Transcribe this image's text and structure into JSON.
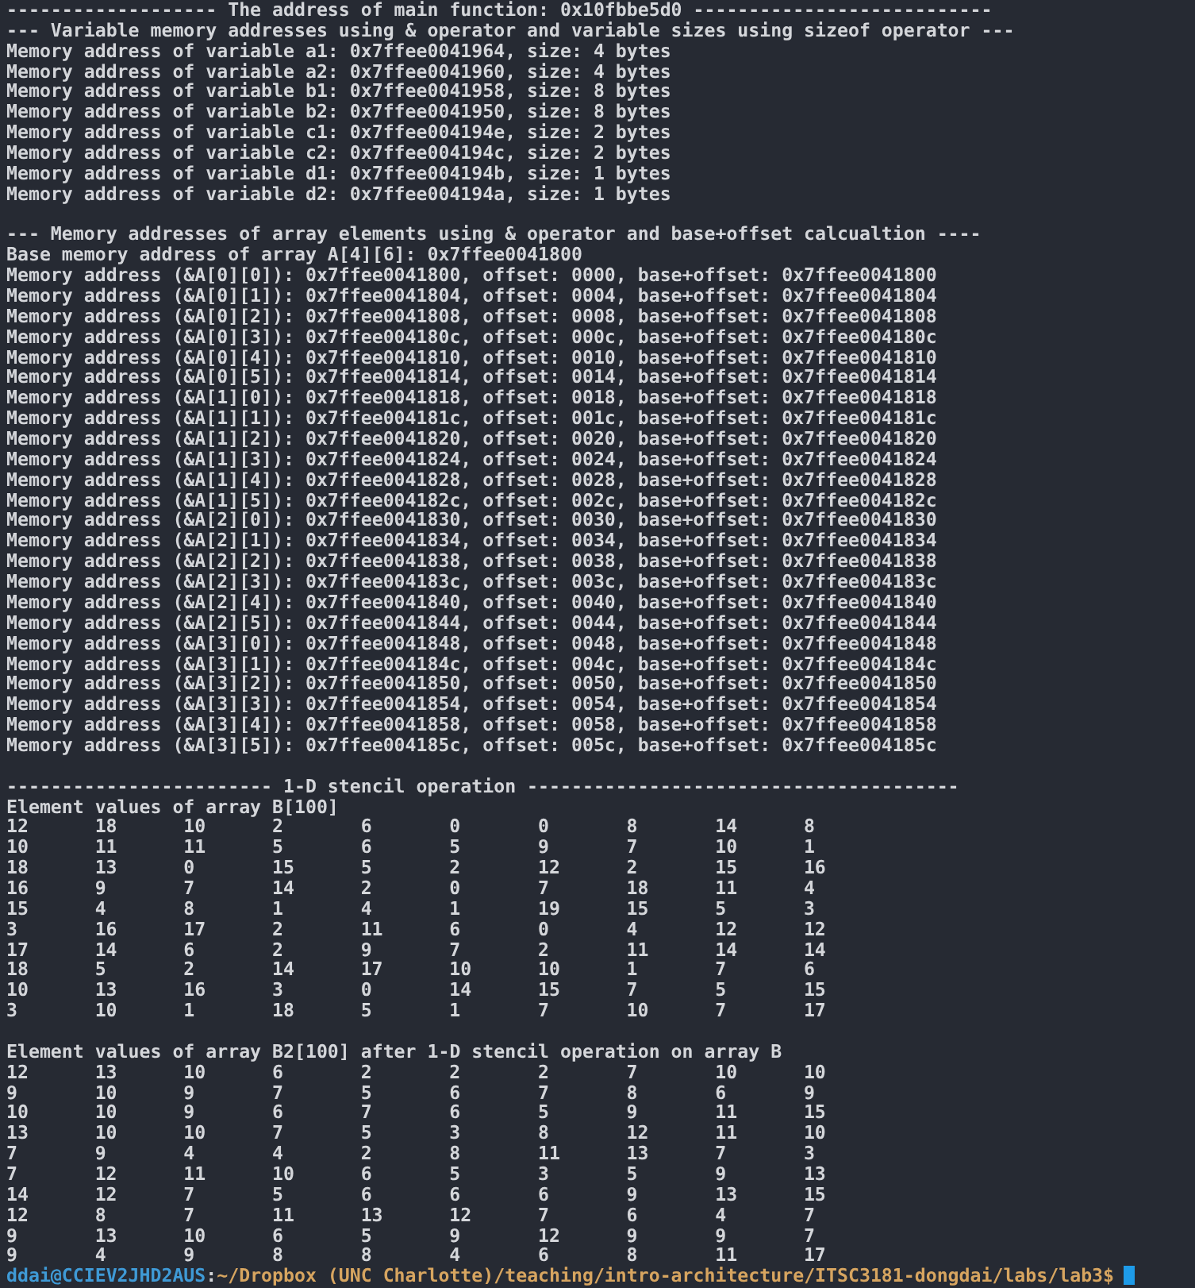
{
  "terminal": {
    "lines": [
      {
        "kind": "text",
        "text": "------------------- The address of main function: 0x10fbbe5d0 ---------------------------"
      },
      {
        "kind": "text",
        "text": "--- Variable memory addresses using & operator and variable sizes using sizeof operator ---"
      },
      {
        "kind": "text",
        "text": "Memory address of variable a1: 0x7ffee0041964, size: 4 bytes"
      },
      {
        "kind": "text",
        "text": "Memory address of variable a2: 0x7ffee0041960, size: 4 bytes"
      },
      {
        "kind": "text",
        "text": "Memory address of variable b1: 0x7ffee0041958, size: 8 bytes"
      },
      {
        "kind": "text",
        "text": "Memory address of variable b2: 0x7ffee0041950, size: 8 bytes"
      },
      {
        "kind": "text",
        "text": "Memory address of variable c1: 0x7ffee004194e, size: 2 bytes"
      },
      {
        "kind": "text",
        "text": "Memory address of variable c2: 0x7ffee004194c, size: 2 bytes"
      },
      {
        "kind": "text",
        "text": "Memory address of variable d1: 0x7ffee004194b, size: 1 bytes"
      },
      {
        "kind": "text",
        "text": "Memory address of variable d2: 0x7ffee004194a, size: 1 bytes"
      },
      {
        "kind": "blank"
      },
      {
        "kind": "text",
        "text": "--- Memory addresses of array elements using & operator and base+offset calcualtion ----"
      },
      {
        "kind": "text",
        "text": "Base memory address of array A[4][6]: 0x7ffee0041800"
      },
      {
        "kind": "text",
        "text": "Memory address (&A[0][0]): 0x7ffee0041800, offset: 0000, base+offset: 0x7ffee0041800"
      },
      {
        "kind": "text",
        "text": "Memory address (&A[0][1]): 0x7ffee0041804, offset: 0004, base+offset: 0x7ffee0041804"
      },
      {
        "kind": "text",
        "text": "Memory address (&A[0][2]): 0x7ffee0041808, offset: 0008, base+offset: 0x7ffee0041808"
      },
      {
        "kind": "text",
        "text": "Memory address (&A[0][3]): 0x7ffee004180c, offset: 000c, base+offset: 0x7ffee004180c"
      },
      {
        "kind": "text",
        "text": "Memory address (&A[0][4]): 0x7ffee0041810, offset: 0010, base+offset: 0x7ffee0041810"
      },
      {
        "kind": "text",
        "text": "Memory address (&A[0][5]): 0x7ffee0041814, offset: 0014, base+offset: 0x7ffee0041814"
      },
      {
        "kind": "text",
        "text": "Memory address (&A[1][0]): 0x7ffee0041818, offset: 0018, base+offset: 0x7ffee0041818"
      },
      {
        "kind": "text",
        "text": "Memory address (&A[1][1]): 0x7ffee004181c, offset: 001c, base+offset: 0x7ffee004181c"
      },
      {
        "kind": "text",
        "text": "Memory address (&A[1][2]): 0x7ffee0041820, offset: 0020, base+offset: 0x7ffee0041820"
      },
      {
        "kind": "text",
        "text": "Memory address (&A[1][3]): 0x7ffee0041824, offset: 0024, base+offset: 0x7ffee0041824"
      },
      {
        "kind": "text",
        "text": "Memory address (&A[1][4]): 0x7ffee0041828, offset: 0028, base+offset: 0x7ffee0041828"
      },
      {
        "kind": "text",
        "text": "Memory address (&A[1][5]): 0x7ffee004182c, offset: 002c, base+offset: 0x7ffee004182c"
      },
      {
        "kind": "text",
        "text": "Memory address (&A[2][0]): 0x7ffee0041830, offset: 0030, base+offset: 0x7ffee0041830"
      },
      {
        "kind": "text",
        "text": "Memory address (&A[2][1]): 0x7ffee0041834, offset: 0034, base+offset: 0x7ffee0041834"
      },
      {
        "kind": "text",
        "text": "Memory address (&A[2][2]): 0x7ffee0041838, offset: 0038, base+offset: 0x7ffee0041838"
      },
      {
        "kind": "text",
        "text": "Memory address (&A[2][3]): 0x7ffee004183c, offset: 003c, base+offset: 0x7ffee004183c"
      },
      {
        "kind": "text",
        "text": "Memory address (&A[2][4]): 0x7ffee0041840, offset: 0040, base+offset: 0x7ffee0041840"
      },
      {
        "kind": "text",
        "text": "Memory address (&A[2][5]): 0x7ffee0041844, offset: 0044, base+offset: 0x7ffee0041844"
      },
      {
        "kind": "text",
        "text": "Memory address (&A[3][0]): 0x7ffee0041848, offset: 0048, base+offset: 0x7ffee0041848"
      },
      {
        "kind": "text",
        "text": "Memory address (&A[3][1]): 0x7ffee004184c, offset: 004c, base+offset: 0x7ffee004184c"
      },
      {
        "kind": "text",
        "text": "Memory address (&A[3][2]): 0x7ffee0041850, offset: 0050, base+offset: 0x7ffee0041850"
      },
      {
        "kind": "text",
        "text": "Memory address (&A[3][3]): 0x7ffee0041854, offset: 0054, base+offset: 0x7ffee0041854"
      },
      {
        "kind": "text",
        "text": "Memory address (&A[3][4]): 0x7ffee0041858, offset: 0058, base+offset: 0x7ffee0041858"
      },
      {
        "kind": "text",
        "text": "Memory address (&A[3][5]): 0x7ffee004185c, offset: 005c, base+offset: 0x7ffee004185c"
      },
      {
        "kind": "blank"
      },
      {
        "kind": "text",
        "text": "------------------------ 1-D stencil operation ---------------------------------------"
      },
      {
        "kind": "text",
        "text": "Element values of array B[100]"
      },
      {
        "kind": "values",
        "values": [
          "12",
          "18",
          "10",
          "2",
          "6",
          "0",
          "0",
          "8",
          "14",
          "8"
        ]
      },
      {
        "kind": "values",
        "values": [
          "10",
          "11",
          "11",
          "5",
          "6",
          "5",
          "9",
          "7",
          "10",
          "1"
        ]
      },
      {
        "kind": "values",
        "values": [
          "18",
          "13",
          "0",
          "15",
          "5",
          "2",
          "12",
          "2",
          "15",
          "16"
        ]
      },
      {
        "kind": "values",
        "values": [
          "16",
          "9",
          "7",
          "14",
          "2",
          "0",
          "7",
          "18",
          "11",
          "4"
        ]
      },
      {
        "kind": "values",
        "values": [
          "15",
          "4",
          "8",
          "1",
          "4",
          "1",
          "19",
          "15",
          "5",
          "3"
        ]
      },
      {
        "kind": "values",
        "values": [
          "3",
          "16",
          "17",
          "2",
          "11",
          "6",
          "0",
          "4",
          "12",
          "12"
        ]
      },
      {
        "kind": "values",
        "values": [
          "17",
          "14",
          "6",
          "2",
          "9",
          "7",
          "2",
          "11",
          "14",
          "14"
        ]
      },
      {
        "kind": "values",
        "values": [
          "18",
          "5",
          "2",
          "14",
          "17",
          "10",
          "10",
          "1",
          "7",
          "6"
        ]
      },
      {
        "kind": "values",
        "values": [
          "10",
          "13",
          "16",
          "3",
          "0",
          "14",
          "15",
          "7",
          "5",
          "15"
        ]
      },
      {
        "kind": "values",
        "values": [
          "3",
          "10",
          "1",
          "18",
          "5",
          "1",
          "7",
          "10",
          "7",
          "17"
        ]
      },
      {
        "kind": "blank"
      },
      {
        "kind": "text",
        "text": "Element values of array B2[100] after 1-D stencil operation on array B"
      },
      {
        "kind": "values",
        "values": [
          "12",
          "13",
          "10",
          "6",
          "2",
          "2",
          "2",
          "7",
          "10",
          "10"
        ]
      },
      {
        "kind": "values",
        "values": [
          "9",
          "10",
          "9",
          "7",
          "5",
          "6",
          "7",
          "8",
          "6",
          "9"
        ]
      },
      {
        "kind": "values",
        "values": [
          "10",
          "10",
          "9",
          "6",
          "7",
          "6",
          "5",
          "9",
          "11",
          "15"
        ]
      },
      {
        "kind": "values",
        "values": [
          "13",
          "10",
          "10",
          "7",
          "5",
          "3",
          "8",
          "12",
          "11",
          "10"
        ]
      },
      {
        "kind": "values",
        "values": [
          "7",
          "9",
          "4",
          "4",
          "2",
          "8",
          "11",
          "13",
          "7",
          "3"
        ]
      },
      {
        "kind": "values",
        "values": [
          "7",
          "12",
          "11",
          "10",
          "6",
          "5",
          "3",
          "5",
          "9",
          "13"
        ]
      },
      {
        "kind": "values",
        "values": [
          "14",
          "12",
          "7",
          "5",
          "6",
          "6",
          "6",
          "9",
          "13",
          "15"
        ]
      },
      {
        "kind": "values",
        "values": [
          "12",
          "8",
          "7",
          "11",
          "13",
          "12",
          "7",
          "6",
          "4",
          "7"
        ]
      },
      {
        "kind": "values",
        "values": [
          "9",
          "13",
          "10",
          "6",
          "5",
          "9",
          "12",
          "9",
          "9",
          "7"
        ]
      },
      {
        "kind": "values",
        "values": [
          "9",
          "4",
          "9",
          "8",
          "8",
          "4",
          "6",
          "8",
          "11",
          "17"
        ]
      },
      {
        "kind": "prompt",
        "user_host": "ddai@CCIEV2JHD2AUS",
        "separator": ":",
        "path": "~/Dropbox (UNC Charlotte)/teaching/intro-architecture/ITSC3181-dongdai/labs/lab3$"
      }
    ]
  }
}
